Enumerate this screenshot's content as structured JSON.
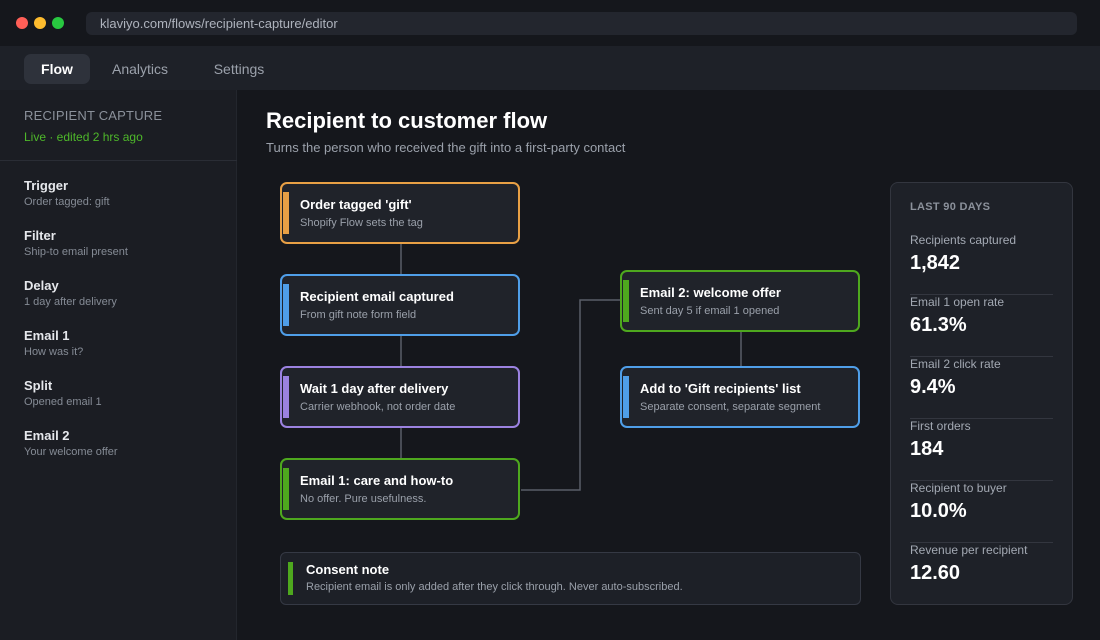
{
  "window": {
    "url": "klaviyo.com/flows/recipient-capture/editor"
  },
  "tabs": [
    {
      "label": "Flow"
    },
    {
      "label": "Analytics"
    },
    {
      "label": "Settings"
    }
  ],
  "sidebar": {
    "heading": "RECIPIENT CAPTURE",
    "status": "Live · edited 2 hrs ago",
    "items": [
      {
        "title": "Trigger",
        "sub": "Order tagged: gift"
      },
      {
        "title": "Filter",
        "sub": "Ship-to email present"
      },
      {
        "title": "Delay",
        "sub": "1 day after delivery"
      },
      {
        "title": "Email 1",
        "sub": "How was it?"
      },
      {
        "title": "Split",
        "sub": "Opened email 1"
      },
      {
        "title": "Email 2",
        "sub": "Your welcome offer"
      }
    ]
  },
  "main": {
    "title": "Recipient to customer flow",
    "subtitle": "Turns the person who received the gift into a first-party contact"
  },
  "flow": {
    "nodes": [
      {
        "title": "Order tagged 'gift'",
        "sub": "Shopify Flow sets the tag",
        "color": "#e8a045"
      },
      {
        "title": "Recipient email captured",
        "sub": "From gift note form field",
        "color": "#4f9ee8"
      },
      {
        "title": "Wait 1 day after delivery",
        "sub": "Carrier webhook, not order date",
        "color": "#9b82e0"
      },
      {
        "title": "Email 1: care and how-to",
        "sub": "No offer. Pure usefulness.",
        "color": "#4ea81e"
      },
      {
        "title": "Email 2: welcome offer",
        "sub": "Sent day 5 if email 1 opened",
        "color": "#4ea81e"
      },
      {
        "title": "Add to 'Gift recipients' list",
        "sub": "Separate consent, separate segment",
        "color": "#4f9ee8"
      }
    ],
    "consent": {
      "title": "Consent note",
      "text": "Recipient email is only added after they click through. Never auto-subscribed."
    }
  },
  "stats": {
    "heading": "LAST 90 DAYS",
    "items": [
      {
        "label": "Recipients captured",
        "value": "1,842"
      },
      {
        "label": "Email 1 open rate",
        "value": "61.3%"
      },
      {
        "label": "Email 2 click rate",
        "value": "9.4%"
      },
      {
        "label": "First orders",
        "value": "184"
      },
      {
        "label": "Recipient to buyer",
        "value": "10.0%"
      },
      {
        "label": "Revenue per recipient",
        "value": "12.60"
      }
    ]
  }
}
